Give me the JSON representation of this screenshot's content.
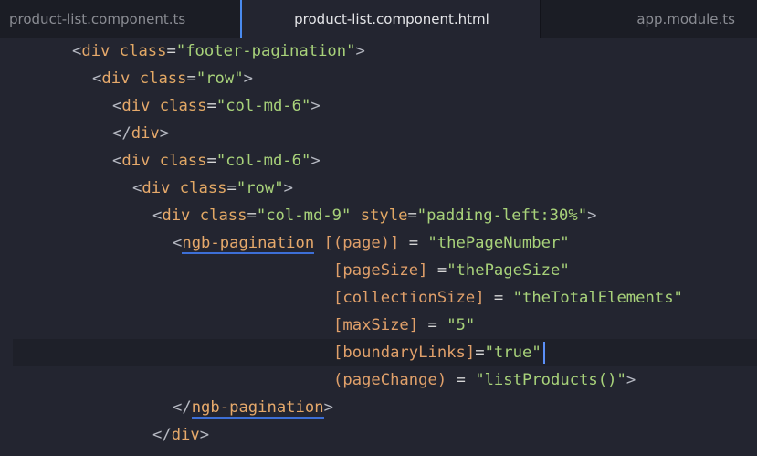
{
  "tabs": [
    {
      "label": "product-list.component.ts"
    },
    {
      "label": "product-list.component.html",
      "active": true
    },
    {
      "label": "app.module.ts"
    }
  ],
  "code": {
    "l1": [
      "<",
      "div",
      " class",
      "=",
      "\"footer-pagination\"",
      ">"
    ],
    "l2": [
      "<",
      "div",
      " class",
      "=",
      "\"row\"",
      ">"
    ],
    "l3": [
      "<",
      "div",
      " class",
      "=",
      "\"col-md-6\"",
      ">"
    ],
    "l4": [
      "</",
      "div",
      ">"
    ],
    "l5": [
      "<",
      "div",
      " class",
      "=",
      "\"col-md-6\"",
      ">"
    ],
    "l6": [
      "<",
      "div",
      " class",
      "=",
      "\"row\"",
      ">"
    ],
    "l7": [
      "<",
      "div",
      " class",
      "=",
      "\"col-md-9\"",
      " style",
      "=",
      "\"padding-left:30%\"",
      ">"
    ],
    "l8": [
      "<",
      "ngb-pagination",
      " [(page)]",
      " = ",
      "\"thePageNumber\""
    ],
    "l9": [
      "[pageSize]",
      " =",
      "\"thePageSize\""
    ],
    "l10": [
      "[collectionSize]",
      " = ",
      "\"theTotalElements\""
    ],
    "l11": [
      "[maxSize]",
      " = ",
      "\"5\""
    ],
    "l12": [
      "[boundaryLinks]",
      "=",
      "\"true\""
    ],
    "l13": [
      "(pageChange)",
      " = ",
      "\"listProducts()\"",
      ">"
    ],
    "l14": [
      "</",
      "ngb-pagination",
      ">"
    ],
    "l15": [
      "</",
      "div",
      ">"
    ]
  },
  "colors": {
    "background": "#232530",
    "tab_bar": "#1b1d25",
    "tag": "#e6a96b",
    "string": "#a8d27a",
    "cursor": "#5b8ff7"
  }
}
